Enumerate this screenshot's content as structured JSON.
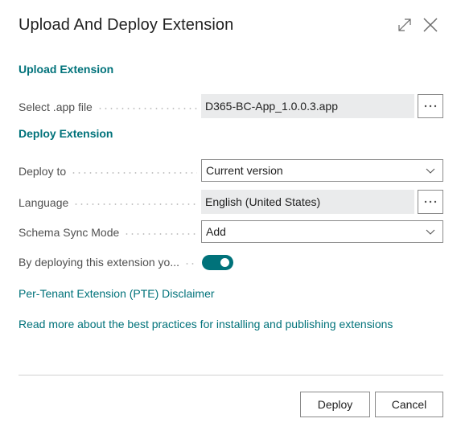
{
  "dialog": {
    "title": "Upload And Deploy Extension",
    "icons": {
      "expand": "expand-icon",
      "close": "close-icon"
    }
  },
  "sections": {
    "upload": "Upload Extension",
    "deploy": "Deploy Extension"
  },
  "fields": {
    "select_file": {
      "label": "Select .app file",
      "value": "D365-BC-App_1.0.0.3.app",
      "assist": "···"
    },
    "deploy_to": {
      "label": "Deploy to",
      "value": "Current version"
    },
    "language": {
      "label": "Language",
      "value": "English (United States)",
      "assist": "···"
    },
    "schema_sync_mode": {
      "label": "Schema Sync Mode",
      "value": "Add"
    },
    "accept_disclaimer": {
      "label": "By deploying this extension yo...",
      "checked": true
    }
  },
  "links": {
    "disclaimer": "Per-Tenant Extension (PTE) Disclaimer",
    "best_practices": "Read more about the best practices for installing and publishing extensions"
  },
  "buttons": {
    "deploy": "Deploy",
    "cancel": "Cancel"
  },
  "colors": {
    "accent": "#00727a",
    "readonly_bg": "#eaebec",
    "border": "#8a8a8a"
  }
}
